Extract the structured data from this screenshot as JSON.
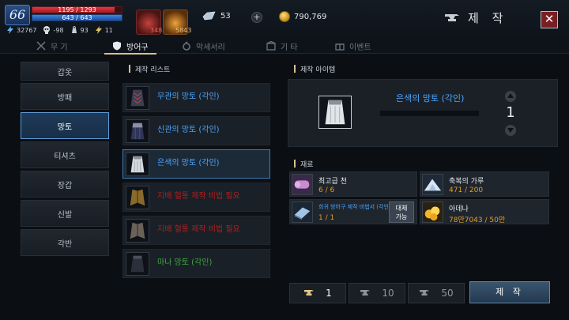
{
  "player": {
    "level": "66",
    "hp": "1195 / 1293",
    "hp_fraction": 0.924,
    "mp": "643 / 643",
    "mp_fraction": 1.0,
    "stats": [
      "32767",
      "-98",
      "93",
      "11"
    ]
  },
  "consumables": [
    {
      "icon": "red-potion-icon",
      "count": "348"
    },
    {
      "icon": "orange-potion-icon",
      "count": "5843"
    }
  ],
  "currency": {
    "crystal": "53",
    "gold": "790,769"
  },
  "header": {
    "title": "제 작"
  },
  "tabs": [
    {
      "label": "무 기",
      "icon": "swords-icon",
      "active": false
    },
    {
      "label": "방어구",
      "icon": "shield-icon",
      "active": true
    },
    {
      "label": "악세서리",
      "icon": "ring-icon",
      "active": false
    },
    {
      "label": "기 타",
      "icon": "box-icon",
      "active": false
    },
    {
      "label": "이벤트",
      "icon": "gift-icon",
      "active": false
    }
  ],
  "categories": [
    {
      "label": "갑옷",
      "active": false
    },
    {
      "label": "방패",
      "active": false
    },
    {
      "label": "망토",
      "active": true
    },
    {
      "label": "티셔츠",
      "active": false
    },
    {
      "label": "장갑",
      "active": false
    },
    {
      "label": "신발",
      "active": false
    },
    {
      "label": "각반",
      "active": false
    }
  ],
  "recipe_list": {
    "title": "제작 리스트",
    "items": [
      {
        "name": "무관의 망토 (각인)",
        "color": "blue",
        "icon": "cloak-icon"
      },
      {
        "name": "신관의 망토 (각인)",
        "color": "blue",
        "icon": "cloak-icon"
      },
      {
        "name": "은색의 망토 (각인)",
        "color": "blue",
        "icon": "cloak-icon",
        "selected": true
      },
      {
        "name": "지배 혈통 제작 비법 필요",
        "color": "red",
        "icon": "cloak-icon"
      },
      {
        "name": "지배 혈통 제작 비법 필요",
        "color": "red",
        "icon": "cloak-icon"
      },
      {
        "name": "마나 망토 (각인)",
        "color": "green",
        "icon": "cloak-icon"
      }
    ]
  },
  "craft_item": {
    "title": "제작 아이템",
    "name": "은색의 망토 (각인)",
    "quantity": "1"
  },
  "materials": {
    "title": "재료",
    "items": [
      {
        "name": "최고급 천",
        "count": "6 / 6",
        "icon": "cloth-icon"
      },
      {
        "name": "축복의 가루",
        "count": "471 / 200",
        "icon": "powder-icon"
      },
      {
        "name": "희귀 방어구 제작 비법서 (각인)",
        "count": "1 / 1",
        "icon": "recipe-book-icon",
        "substitute": "대체\n가능"
      },
      {
        "name": "아데나",
        "count": "78만7043 / 50만",
        "icon": "adena-icon"
      }
    ]
  },
  "quantity_buttons": [
    "1",
    "10",
    "50"
  ],
  "craft_button": "제 작",
  "colors": {
    "accent": "#d9c08a",
    "blue_text": "#4aa6ff",
    "red_text": "#b21e1e",
    "green_text": "#3fa83f",
    "count_text": "#e29b2a"
  }
}
